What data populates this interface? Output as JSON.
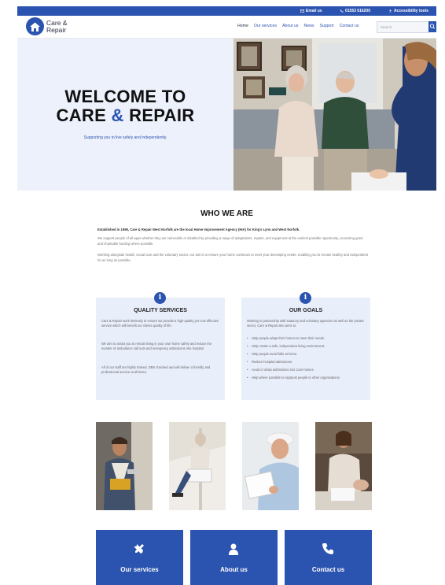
{
  "topbar": {
    "email": "Email us",
    "phone": "01553 616200",
    "accessibility": "Accessibility tools"
  },
  "header": {
    "logo_line1": "Care &",
    "logo_line2": "Repair",
    "nav": [
      "Home",
      "Our services",
      "About us",
      "News",
      "Support",
      "Contact us"
    ],
    "search_placeholder": "Search"
  },
  "hero": {
    "title_line1": "WELCOME TO",
    "title_care": "CARE",
    "title_amp": "&",
    "title_repair": "REPAIR",
    "tagline": "Supporting you to live safely and independently."
  },
  "who": {
    "heading": "WHO WE ARE",
    "intro": "Established in 1998, Care & Repair West Norfolk are the local Home Improvement Agency (HIA) for King's Lynn and West Norfolk.",
    "p1": "We support people of all ages whether they are vulnerable or disabled by providing a range of adaptations, repairs, and equipment at the earliest possible opportunity, accessing grant and charitable funding where possible.",
    "p2": "Working alongside health, social care and the voluntary sector, our aim is to ensure your home continues to meet your developing needs, enabling you to remain healthy and independent for as long as possible."
  },
  "cards": {
    "quality": {
      "title": "QUALITY SERVICES",
      "p1": "Care & Repair work tirelessly to ensure we provide a high-quality yet cost effective service which will benefit our clients quality of life.",
      "p2": "We aim to assist you to remain living in your own home safely and reduce the number of ambulance call outs and emergency admissions into hospital.",
      "p3": "All of our staff are highly trained, DBS checked and will deliver a friendly and professional service at all times."
    },
    "goals": {
      "title": "OUR GOALS",
      "intro": "Working in partnership with statutory and voluntary agencies as well as the private sector, Care & Repair also aims to:",
      "items": [
        "Help people adapt their homes to meet their needs.",
        "Help create a safe, independent living environment.",
        "Help people avoid falls at home.",
        "Reduce hospital admissions.",
        "Avoid or delay admissions into Care homes.",
        "Help where possible to signpost people to other organisations"
      ]
    }
  },
  "buttons": {
    "services": "Our services",
    "about": "About us",
    "contact": "Contact us"
  },
  "colors": {
    "brand_blue": "#2b54b0",
    "hero_bg": "#edf1fb",
    "card_bg": "#e9eefb"
  }
}
